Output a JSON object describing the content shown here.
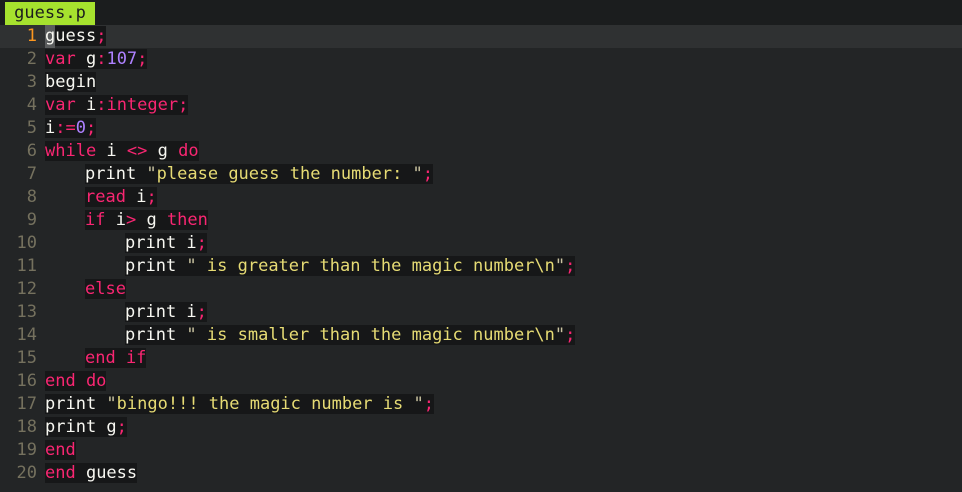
{
  "tab": {
    "filename": "guess.p"
  },
  "colors": {
    "keyword": "#f92672",
    "identifier": "#f8f8f2",
    "number": "#ae81ff",
    "string": "#e6db74",
    "line_number": "#75715e",
    "current_line_number": "#fd971f",
    "tab_background": "#a6e22e",
    "editor_background": "#232526"
  },
  "editor": {
    "current_line": 1,
    "lines": [
      {
        "n": "1",
        "indent": 0,
        "tokens": [
          [
            "id",
            "guess"
          ],
          [
            "op",
            ";"
          ]
        ]
      },
      {
        "n": "2",
        "indent": 0,
        "tokens": [
          [
            "kw",
            "var"
          ],
          [
            "id",
            " g"
          ],
          [
            "op",
            ":"
          ],
          [
            "num",
            "107"
          ],
          [
            "op",
            ";"
          ]
        ]
      },
      {
        "n": "3",
        "indent": 0,
        "tokens": [
          [
            "id",
            "begin"
          ]
        ]
      },
      {
        "n": "4",
        "indent": 0,
        "tokens": [
          [
            "kw",
            "var"
          ],
          [
            "id",
            " i"
          ],
          [
            "op",
            ":"
          ],
          [
            "kw",
            "integer"
          ],
          [
            "op",
            ";"
          ]
        ]
      },
      {
        "n": "5",
        "indent": 0,
        "tokens": [
          [
            "id",
            "i"
          ],
          [
            "op",
            ":="
          ],
          [
            "num",
            "0"
          ],
          [
            "op",
            ";"
          ]
        ]
      },
      {
        "n": "6",
        "indent": 0,
        "tokens": [
          [
            "kw",
            "while"
          ],
          [
            "id",
            " i "
          ],
          [
            "op",
            "<>"
          ],
          [
            "id",
            " g "
          ],
          [
            "kw",
            "do"
          ]
        ]
      },
      {
        "n": "7",
        "indent": 1,
        "tokens": [
          [
            "id",
            "print "
          ],
          [
            "quo",
            "\""
          ],
          [
            "str",
            "please guess the number: "
          ],
          [
            "quo",
            "\""
          ],
          [
            "op",
            ";"
          ]
        ]
      },
      {
        "n": "8",
        "indent": 1,
        "tokens": [
          [
            "kw",
            "read"
          ],
          [
            "id",
            " i"
          ],
          [
            "op",
            ";"
          ]
        ]
      },
      {
        "n": "9",
        "indent": 1,
        "tokens": [
          [
            "kw",
            "if"
          ],
          [
            "id",
            " i"
          ],
          [
            "op",
            ">"
          ],
          [
            "id",
            " g "
          ],
          [
            "kw",
            "then"
          ]
        ]
      },
      {
        "n": "10",
        "indent": 2,
        "tokens": [
          [
            "id",
            "print i"
          ],
          [
            "op",
            ";"
          ]
        ]
      },
      {
        "n": "11",
        "indent": 2,
        "tokens": [
          [
            "id",
            "print "
          ],
          [
            "quo",
            "\""
          ],
          [
            "str",
            " is greater than the magic number\\n"
          ],
          [
            "quo",
            "\""
          ],
          [
            "op",
            ";"
          ]
        ]
      },
      {
        "n": "12",
        "indent": 1,
        "tokens": [
          [
            "kw",
            "else"
          ]
        ]
      },
      {
        "n": "13",
        "indent": 2,
        "tokens": [
          [
            "id",
            "print i"
          ],
          [
            "op",
            ";"
          ]
        ]
      },
      {
        "n": "14",
        "indent": 2,
        "tokens": [
          [
            "id",
            "print "
          ],
          [
            "quo",
            "\""
          ],
          [
            "str",
            " is smaller than the magic number\\n"
          ],
          [
            "quo",
            "\""
          ],
          [
            "op",
            ";"
          ]
        ]
      },
      {
        "n": "15",
        "indent": 1,
        "tokens": [
          [
            "kw",
            "end if"
          ]
        ]
      },
      {
        "n": "16",
        "indent": 0,
        "tokens": [
          [
            "kw",
            "end do"
          ]
        ]
      },
      {
        "n": "17",
        "indent": 0,
        "tokens": [
          [
            "id",
            "print "
          ],
          [
            "quo",
            "\""
          ],
          [
            "str",
            "bingo!!! the magic number is "
          ],
          [
            "quo",
            "\""
          ],
          [
            "op",
            ";"
          ]
        ]
      },
      {
        "n": "18",
        "indent": 0,
        "tokens": [
          [
            "id",
            "print g"
          ],
          [
            "op",
            ";"
          ]
        ]
      },
      {
        "n": "19",
        "indent": 0,
        "tokens": [
          [
            "kw",
            "end"
          ]
        ]
      },
      {
        "n": "20",
        "indent": 0,
        "tokens": [
          [
            "kw",
            "end"
          ],
          [
            "id",
            " guess"
          ]
        ]
      }
    ]
  }
}
